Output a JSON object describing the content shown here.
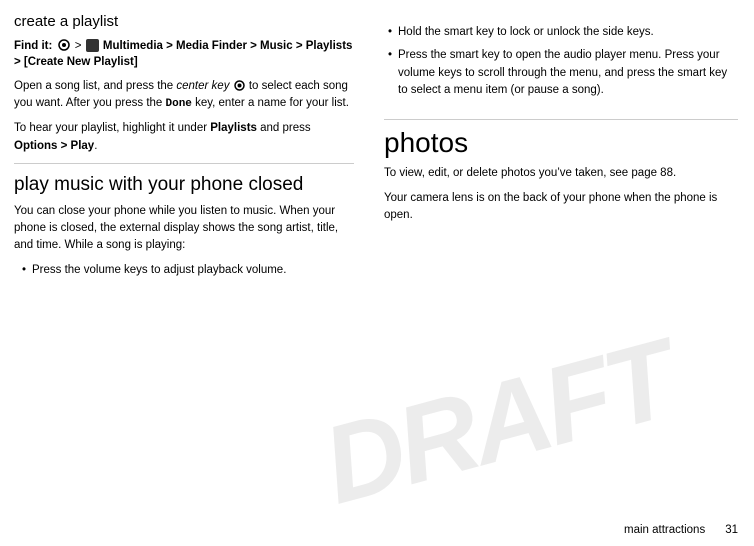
{
  "page": {
    "left_column": {
      "section1": {
        "title": "create a playlist",
        "find_it_label": "Find it:",
        "find_it_path": "Multimedia > Media Finder > Music > Playlists > [Create New Playlist]",
        "para1": "Open a song list, and press the center key",
        "para1_suffix": "to select each song you want. After you press the Done key, enter a name for your list.",
        "para2": "To hear your playlist, highlight it under Playlists and press Options > Play."
      },
      "section2": {
        "title": "play music with your phone closed",
        "para1": "You can close your phone while you listen to music. When your phone is closed, the external display shows the song artist, title, and time. While a song is playing:",
        "bullets": [
          {
            "bold_text": "Press the volume keys",
            "rest_text": " to adjust playback volume."
          }
        ]
      }
    },
    "right_column": {
      "bullets": [
        {
          "bold_text": "Hold the smart key",
          "rest_text": " to lock or unlock the side keys."
        },
        {
          "bold_text": "Press the smart key",
          "rest_text": " to open the audio player menu. Press your volume keys to scroll through the menu, and press the smart key to select a menu item (or pause a song)."
        }
      ],
      "section_photos": {
        "title": "photos",
        "para1": "To view, edit, or delete photos you’ve taken, see page 88.",
        "para2": "Your camera lens is on the back of your phone when the phone is open."
      }
    },
    "footer": {
      "text": "main attractions",
      "page_number": "31"
    },
    "watermark": "DRAFT"
  }
}
